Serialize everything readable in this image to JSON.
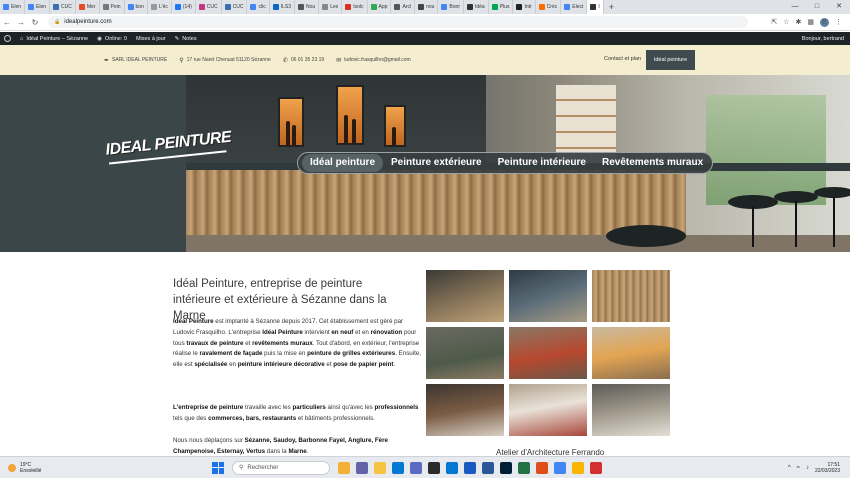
{
  "browser": {
    "tabs": [
      {
        "label": "Elen",
        "color": "#4285f4"
      },
      {
        "label": "Elen",
        "color": "#4285f4"
      },
      {
        "label": "CUC",
        "color": "#3a6fb0"
      },
      {
        "label": "Mer",
        "color": "#e44d26"
      },
      {
        "label": "Pein",
        "color": "#777777"
      },
      {
        "label": "bon",
        "color": "#4285f4"
      },
      {
        "label": "L'éc",
        "color": "#999999"
      },
      {
        "label": "(14)",
        "color": "#1877f2"
      },
      {
        "label": "CUC",
        "color": "#c13584"
      },
      {
        "label": "CUC",
        "color": "#3a6fb0"
      },
      {
        "label": "clic",
        "color": "#4285f4"
      },
      {
        "label": "ILS3",
        "color": "#0a66c2"
      },
      {
        "label": "Nou",
        "color": "#555555"
      },
      {
        "label": "Les",
        "color": "#888888"
      },
      {
        "label": "Isolc",
        "color": "#d93025"
      },
      {
        "label": "App",
        "color": "#34a853"
      },
      {
        "label": "Arcl",
        "color": "#555555"
      },
      {
        "label": "nou",
        "color": "#444444"
      },
      {
        "label": "Bonr",
        "color": "#4285f4"
      },
      {
        "label": "Idéa",
        "color": "#333333"
      },
      {
        "label": "Plus",
        "color": "#00a651"
      },
      {
        "label": "Intr",
        "color": "#222222"
      },
      {
        "label": "Créc",
        "color": "#ff6d00"
      },
      {
        "label": "Elect",
        "color": "#4285f4"
      },
      {
        "label": "I",
        "color": "#333333",
        "active": true
      }
    ],
    "url": "idealpeinture.com"
  },
  "adminbar": {
    "site": "Idéal Peinture – Sézanne",
    "online": "Online: 0",
    "updates": "Mises à jour",
    "notes": "Notes",
    "greeting": "Bonjour, bertrand"
  },
  "topbar": {
    "company": "SARL IDEAL PEINTURE",
    "address": "17 rue Naret Chenuat 51120 Sézanne",
    "phone": "06 01 35 23 19",
    "email": "ludovic.frasquilho@gmail.com",
    "contact": "Contact et plan",
    "cta": "Idéal peinture"
  },
  "hero": {
    "logo": "IDEAL PEINTURE",
    "nav": [
      {
        "label": "Idéal peinture",
        "active": true
      },
      {
        "label": "Peinture extérieure",
        "active": false
      },
      {
        "label": "Peinture intérieure",
        "active": false
      },
      {
        "label": "Revêtements muraux",
        "active": false
      }
    ]
  },
  "content": {
    "title": "Idéal Peinture, entreprise de peinture intérieure et extérieure à Sézanne dans la Marne",
    "p1": [
      {
        "t": "Idéal Peinture",
        "b": true
      },
      {
        "t": " est implanté à Sézanne depuis 2017. Cet établissement est géré par Ludovic Frasquilho. L'entreprise ",
        "b": false
      },
      {
        "t": "Idéal Peinture",
        "b": true
      },
      {
        "t": " intervient ",
        "b": false
      },
      {
        "t": "en neuf",
        "b": true
      },
      {
        "t": " et en ",
        "b": false
      },
      {
        "t": "rénovation",
        "b": true
      },
      {
        "t": " pour tous ",
        "b": false
      },
      {
        "t": "travaux de peinture",
        "b": true
      },
      {
        "t": " et ",
        "b": false
      },
      {
        "t": "revêtements muraux",
        "b": true
      },
      {
        "t": ". Tout d'abord, en extérieur, l'entreprise réalise le ",
        "b": false
      },
      {
        "t": "ravalement de façade",
        "b": true
      },
      {
        "t": " puis la mise en ",
        "b": false
      },
      {
        "t": "peinture de grilles extérieures",
        "b": true
      },
      {
        "t": ". Ensuite, elle est ",
        "b": false
      },
      {
        "t": "spécialisée",
        "b": true
      },
      {
        "t": " en ",
        "b": false
      },
      {
        "t": "peinture intérieure décorative",
        "b": true
      },
      {
        "t": " et ",
        "b": false
      },
      {
        "t": "pose de papier peint",
        "b": true
      },
      {
        "t": ".",
        "b": false
      }
    ],
    "p2": [
      {
        "t": "L'entreprise de peinture",
        "b": true
      },
      {
        "t": " travaille avec les ",
        "b": false
      },
      {
        "t": "particuliers",
        "b": true
      },
      {
        "t": " ainsi qu'avec les ",
        "b": false
      },
      {
        "t": "professionnels",
        "b": true
      },
      {
        "t": " tels que des ",
        "b": false
      },
      {
        "t": "commerces, bars, restaurants",
        "b": true
      },
      {
        "t": " et bâtiments professionnels.",
        "b": false
      }
    ],
    "p3": [
      {
        "t": "Nous nous déplaçons sur ",
        "b": false
      },
      {
        "t": "Sézanne, Saudoy, Barbonne Fayel, Anglure, Fère Champenoise, Esternay, Vertus",
        "b": true
      },
      {
        "t": " dans la ",
        "b": false
      },
      {
        "t": "Marne",
        "b": true
      },
      {
        "t": ".",
        "b": false
      }
    ],
    "gallery_subtitle": "Atelier d'Architecture Ferrando"
  },
  "taskbar": {
    "temp": "19°C",
    "weather": "Ensoleillé",
    "search": "Rechercher",
    "time": "17:51",
    "date": "22/03/2023"
  }
}
